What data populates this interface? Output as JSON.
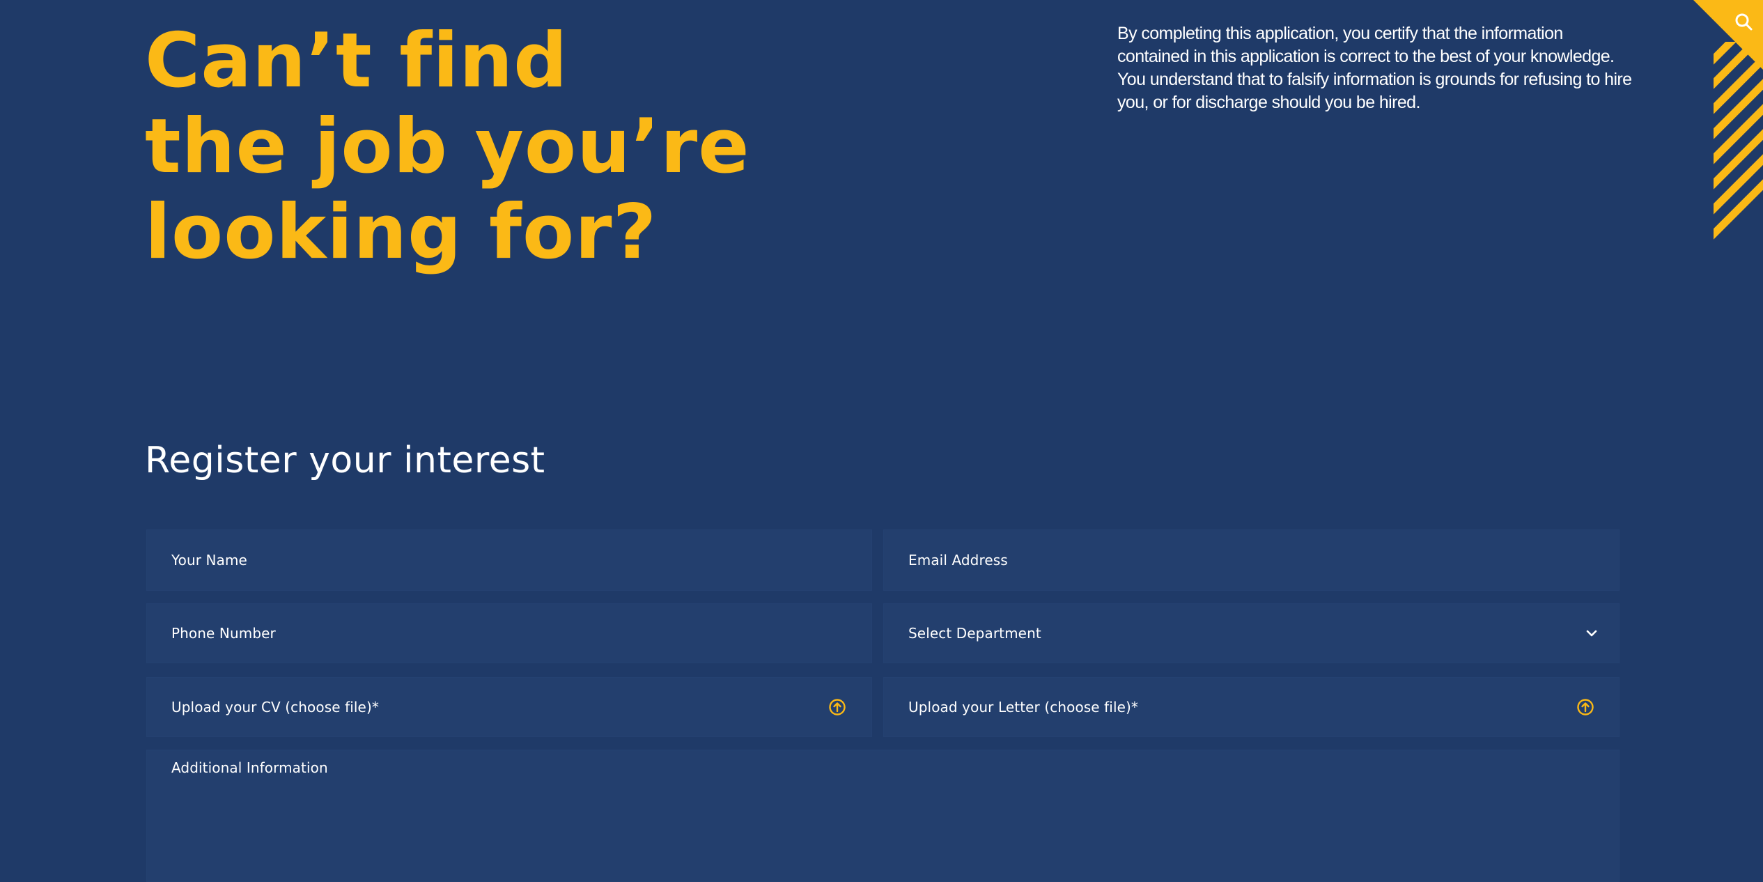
{
  "hero": {
    "headline_lines": [
      "Can’t find",
      "the job you’re",
      "looking for?"
    ],
    "disclaimer": "By completing this application, you certify that the information contained in this application is correct to the best of your knowledge. You understand that to falsify information is grounds for refusing to hire you, or for discharge should you be hired."
  },
  "corner": {
    "search_icon": "search-icon"
  },
  "form": {
    "title": "Register your interest",
    "fields": {
      "name": {
        "placeholder": "Your Name",
        "value": ""
      },
      "email": {
        "placeholder": "Email Address",
        "value": ""
      },
      "phone": {
        "placeholder": "Phone Number",
        "value": ""
      },
      "department": {
        "selected": "Select Department",
        "icon": "chevron-down-icon"
      },
      "cv": {
        "label": "Upload your CV (choose file)*",
        "icon": "upload-icon"
      },
      "letter": {
        "label": "Upload your Letter (choose file)*",
        "icon": "upload-icon"
      },
      "additional": {
        "placeholder": "Additional Information",
        "value": ""
      }
    }
  },
  "colors": {
    "background": "#1f3a68",
    "field_background": "#233f6e",
    "accent_yellow": "#fbb916",
    "text": "#ffffff"
  }
}
